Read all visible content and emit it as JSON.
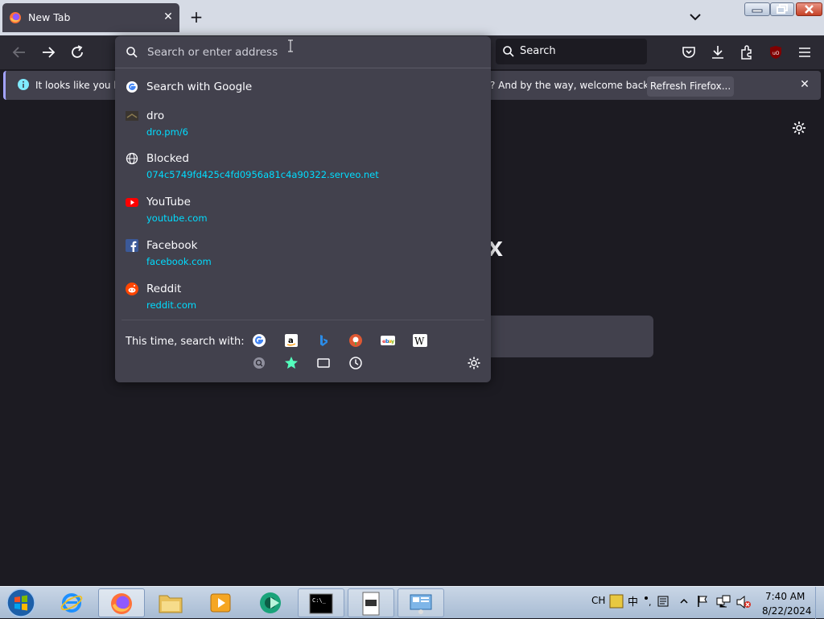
{
  "window": {
    "tab_title": "New Tab",
    "tab_close": "✕",
    "new_tab": "+"
  },
  "toolbar": {
    "search_label": "Search"
  },
  "notification": {
    "text_left": "It looks like you ha",
    "text_right": "? And by the way, welcome back!",
    "refresh_button": "Refresh Firefox...",
    "close": "✕"
  },
  "urlbar": {
    "placeholder": "Search or enter address",
    "results": [
      {
        "title": "Search with Google",
        "url": "",
        "icon": "google-icon"
      },
      {
        "title": "dro",
        "url": "dro.pm/6",
        "icon": "site-favicon-icon"
      },
      {
        "title": "Blocked",
        "url": "074c5749fd425c4fd0956a81c4a90322.serveo.net",
        "icon": "globe-icon"
      },
      {
        "title": "YouTube",
        "url": "youtube.com",
        "icon": "youtube-icon"
      },
      {
        "title": "Facebook",
        "url": "facebook.com",
        "icon": "facebook-icon"
      },
      {
        "title": "Reddit",
        "url": "reddit.com",
        "icon": "reddit-icon"
      }
    ],
    "oneoff_label": "This time, search with:",
    "oneoff_engines": [
      "google-icon",
      "amazon-icon",
      "bing-icon",
      "duckduckgo-icon",
      "ebay-icon",
      "wikipedia-icon"
    ],
    "oneoff_modes": [
      "search-tabs-icon",
      "bookmarks-icon",
      "tabs-icon",
      "history-icon"
    ]
  },
  "page": {
    "logo_fragment": "x"
  },
  "taskbar": {
    "language": "CH",
    "time": "7:40 AM",
    "date": "8/22/2024"
  },
  "colors": {
    "accent_link": "#00ddff",
    "popup_bg": "#42414d",
    "page_bg": "#1c1b22"
  }
}
